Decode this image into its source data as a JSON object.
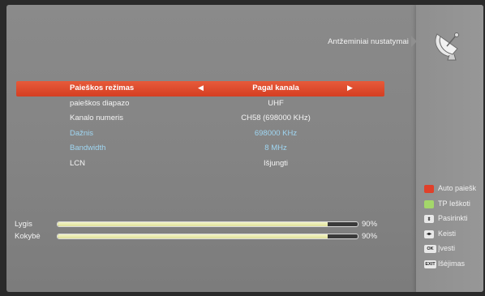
{
  "header": {
    "title": "Antžeminiai nustatymai",
    "icon": "satellite-dish-icon"
  },
  "menu": {
    "rows": [
      {
        "label": "Paieškos režimas",
        "value": "Pagal kanala"
      },
      {
        "label": "paieškos diapazo",
        "value": "UHF"
      },
      {
        "label": "Kanalo numeris",
        "value": "CH58 (698000 KHz)"
      },
      {
        "label": "Dažnis",
        "value": "698000 KHz"
      },
      {
        "label": "Bandwidth",
        "value": "8 MHz"
      },
      {
        "label": "LCN",
        "value": "Išjungti"
      }
    ],
    "arrow_left": "◀",
    "arrow_right": "▶"
  },
  "signal": {
    "level": {
      "label": "Lygis",
      "percent_text": "90%",
      "value": 0.9
    },
    "quality": {
      "label": "Kokybė",
      "percent_text": "90%",
      "value": 0.9
    }
  },
  "legend": [
    {
      "key": "",
      "text": "Auto paiešk"
    },
    {
      "key": "",
      "text": "TP Ieškoti"
    },
    {
      "key": "⇕",
      "text": "Pasirinkti"
    },
    {
      "key": "◂▸",
      "text": "Keisti"
    },
    {
      "key": "OK",
      "text": "Įvesti"
    },
    {
      "key": "EXIT",
      "text": "Išėjimas"
    }
  ],
  "colors": {
    "highlight": "#d84526",
    "blue_text": "#9fd6f2",
    "red_key": "#e0402a",
    "green_key": "#a4d76a",
    "bar_fill": "#e6e8aa"
  }
}
